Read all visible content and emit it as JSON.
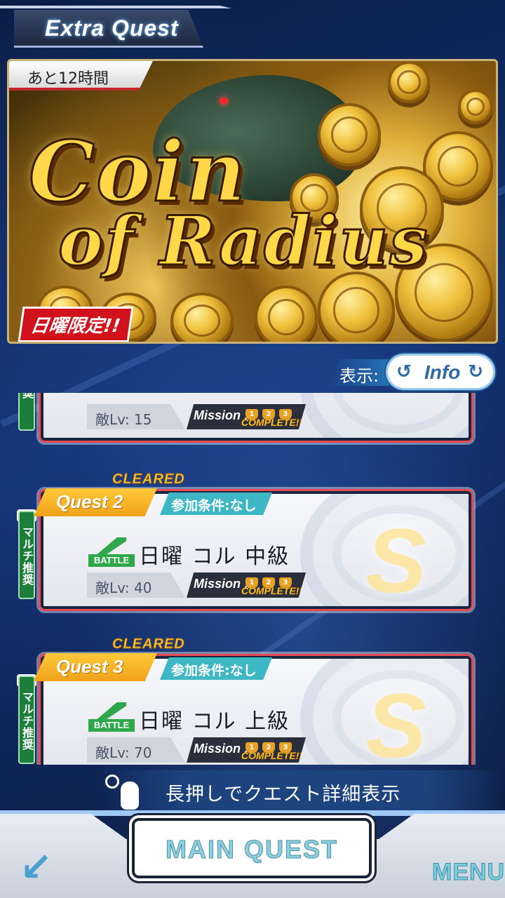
{
  "header": {
    "title": "Extra Quest"
  },
  "banner": {
    "timer": "あと12時間",
    "logo_line1": "Coin",
    "logo_line2": "of Radius",
    "badge": "日曜限定!!"
  },
  "display": {
    "label": "表示:",
    "mode": "Info"
  },
  "quests": [
    {
      "partial": true,
      "multi_tag": "推奨",
      "enemy_lv": "敵Lv: 15",
      "mission_label": "Mission :",
      "mission_status": "COMPLETE!!",
      "trophies": [
        "1",
        "2",
        "3"
      ]
    },
    {
      "cleared": "CLEARED",
      "label": "Quest 2",
      "condition": "参加条件:なし",
      "battle": "BATTLE",
      "name": "日曜 コル 中級",
      "multi_tag": "マルチ推奨",
      "enemy_lv": "敵Lv: 40",
      "mission_label": "Mission :",
      "mission_status": "COMPLETE!!",
      "trophies": [
        "1",
        "2",
        "3"
      ],
      "rank": "S"
    },
    {
      "cleared": "CLEARED",
      "label": "Quest 3",
      "condition": "参加条件:なし",
      "battle": "BATTLE",
      "name": "日曜 コル 上級",
      "multi_tag": "マルチ推奨",
      "enemy_lv": "敵Lv: 70",
      "mission_label": "Mission :",
      "mission_status": "COMPLETE!!",
      "trophies": [
        "1",
        "2",
        "3"
      ],
      "rank": "S"
    }
  ],
  "hint": {
    "text": "長押しでクエスト詳細表示"
  },
  "bottom": {
    "main_quest": "MAIN QUEST",
    "menu": "MENU",
    "back_icon": "back-arrow-icon"
  }
}
